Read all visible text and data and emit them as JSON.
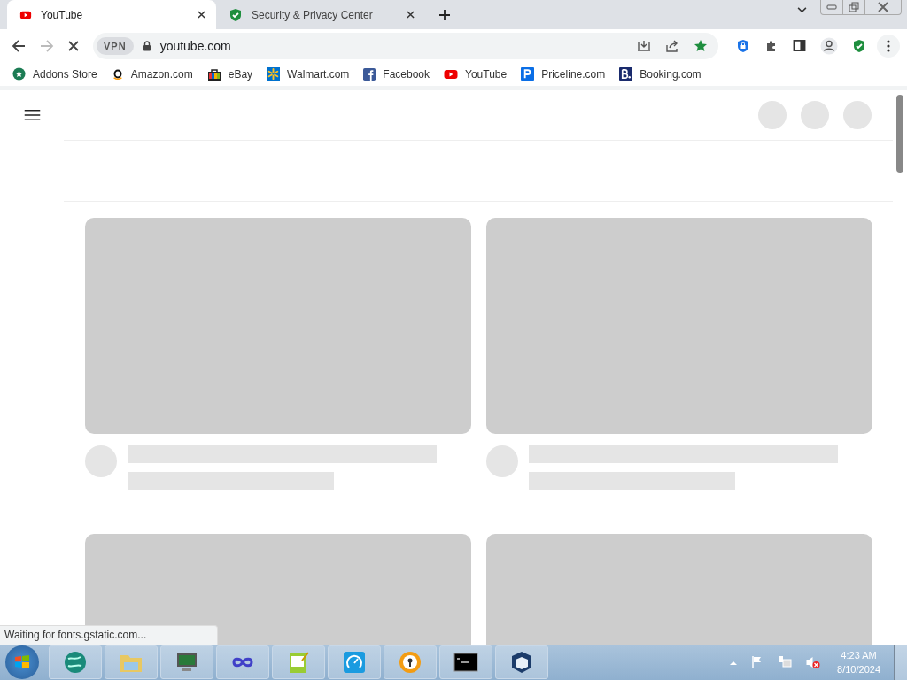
{
  "tabs": [
    {
      "title": "YouTube",
      "kind": "youtube",
      "selected": true
    },
    {
      "title": "Security & Privacy Center",
      "kind": "shield",
      "selected": false
    }
  ],
  "toolbar": {
    "vpn_badge": "VPN",
    "address": "youtube.com",
    "loading": true
  },
  "bookmarks": [
    {
      "label": "Addons Store",
      "kind": "addons"
    },
    {
      "label": "Amazon.com",
      "kind": "amazon"
    },
    {
      "label": "eBay",
      "kind": "ebay"
    },
    {
      "label": "Walmart.com",
      "kind": "walmart"
    },
    {
      "label": "Facebook",
      "kind": "facebook"
    },
    {
      "label": "YouTube",
      "kind": "youtube"
    },
    {
      "label": "Priceline.com",
      "kind": "priceline"
    },
    {
      "label": "Booking.com",
      "kind": "booking"
    }
  ],
  "status_bar": "Waiting for fonts.gstatic.com...",
  "taskbar": {
    "apps": [
      {
        "kind": "globe"
      },
      {
        "kind": "folder"
      },
      {
        "kind": "monitor"
      },
      {
        "kind": "infinity"
      },
      {
        "kind": "notepad"
      },
      {
        "kind": "gauge"
      },
      {
        "kind": "lock"
      },
      {
        "kind": "terminal"
      },
      {
        "kind": "cube"
      }
    ],
    "clock": {
      "time": "4:23 AM",
      "date": "8/10/2024"
    }
  }
}
